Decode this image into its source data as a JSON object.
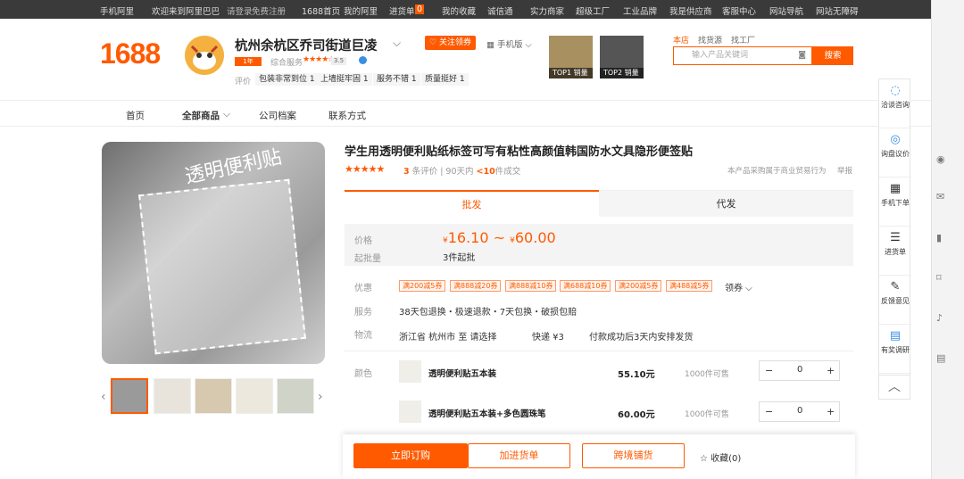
{
  "topbar": {
    "mobile": "手机阿里",
    "welcome": "欢迎来到阿里巴巴",
    "login": "请登录",
    "register": "免费注册",
    "home": "1688首页",
    "my_ali": "我的阿里",
    "purchase": "进货单",
    "purchase_count": "0",
    "favorites": "我的收藏",
    "trust": "诚信通",
    "merchants": "实力商家",
    "super_factory": "超级工厂",
    "industrial": "工业品牌",
    "supplier": "我是供应商",
    "service": "客服中心",
    "site_nav": "网站导航",
    "accessible": "网站无障碍"
  },
  "header": {
    "logo": "1688",
    "shop_name": "杭州余杭区乔司街道巨凌",
    "follow": "关注领券",
    "mobile": "手机版",
    "years": "1年",
    "service_label": "综合服务",
    "score": "3.5",
    "eval_label": "评价",
    "eval_tags": [
      "包装非常到位 1",
      "上墙挺牢固 1",
      "服务不错 1",
      "质量挺好 1"
    ],
    "top1": "TOP1 销量",
    "top2": "TOP2 销量",
    "search_tabs": [
      "本店",
      "找货源",
      "找工厂"
    ],
    "search_placeholder": "输入产品关键词",
    "search_btn": "搜索"
  },
  "nav": {
    "items": [
      "首页",
      "全部商品",
      "公司档案",
      "联系方式"
    ]
  },
  "product": {
    "title": "学生用透明便利贴纸标签可写有粘性高颜值韩国防水文具隐形便签贴",
    "review_count": "3",
    "reviews_text": "条评价",
    "sales_text": "90天内",
    "sales_count": "<10",
    "sales_unit": "件成交",
    "procure": "本产品采购属于商业贸易行为",
    "report": "举报",
    "main_img_text": "透明便利贴"
  },
  "tabs": {
    "wholesale": "批发",
    "dropship": "代发"
  },
  "pricing": {
    "price_label": "价格",
    "price_low": "16.10",
    "tilde": "~",
    "price_high": "60.00",
    "moq_label": "起批量",
    "moq": "3件起批",
    "currency": "¥"
  },
  "coupons": [
    "满200减5券",
    "满888减20券",
    "满888减10券",
    "满688减10券",
    "满200减5券",
    "满488减5券"
  ],
  "coupon_action": "领券",
  "rows": {
    "service_label": "服务",
    "service": "38天包退换・极速退款・7天包换・破损包赔",
    "logistics_label": "物流",
    "logistics": "浙江省 杭州市  至  请选择",
    "express": "快递 ¥3",
    "ship": "付款成功后3天内安排发货",
    "offer_label": "优惠"
  },
  "color_label": "颜色",
  "variants": [
    {
      "name": "透明便利贴五本装",
      "price": "55.10元",
      "stock": "1000件可售",
      "qty": "0"
    },
    {
      "name": "透明便利贴五本装+多色圆珠笔",
      "price": "60.00元",
      "stock": "1000件可售",
      "qty": "0"
    }
  ],
  "bottom": {
    "order": "立即订购",
    "cart": "加进货单",
    "cross": "跨境铺货",
    "fav": "收藏(0)"
  },
  "sidebar": [
    {
      "label": "洽谈咨询",
      "icon": "chat-icon"
    },
    {
      "label": "询盘议价",
      "icon": "inquiry-icon"
    },
    {
      "label": "手机下单",
      "icon": "qr-icon"
    },
    {
      "label": "进货单",
      "icon": "list-icon"
    },
    {
      "label": "反馈意见",
      "icon": "edit-icon"
    },
    {
      "label": "有奖调研",
      "icon": "survey-icon"
    }
  ],
  "accent_color": "#ff5a00"
}
